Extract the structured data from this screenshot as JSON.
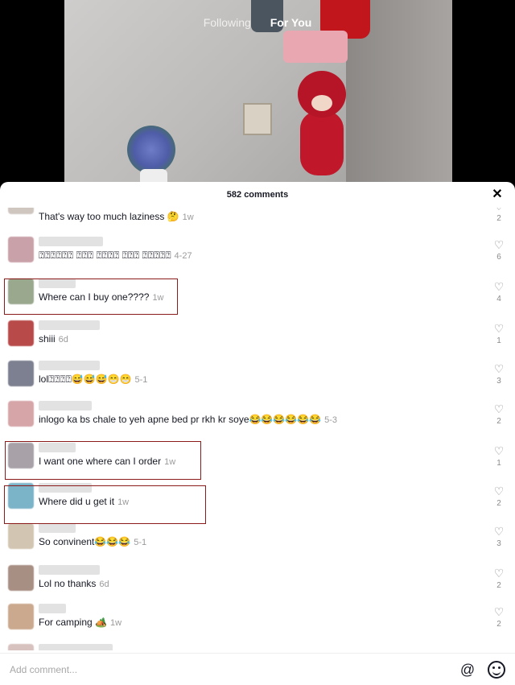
{
  "feed_tabs": {
    "following": "Following",
    "for_you": "For You"
  },
  "comments_header": "582 comments",
  "comments": [
    {
      "text": "That's way too much laziness 🤔",
      "time": "1w",
      "likes": "2",
      "avatar_color": "#cfc6c0"
    },
    {
      "text": "⍰⍰⍰⍰⍰⍰ ⍰⍰⍰ ⍰⍰⍰⍰ ⍰⍰⍰ ⍰⍰⍰⍰⍰",
      "time": "4-27",
      "likes": "6",
      "avatar_color": "#c9a1a8"
    },
    {
      "text": "Where can I buy one????",
      "time": "1w",
      "likes": "4",
      "avatar_color": "#9aa88e"
    },
    {
      "text": "shiii",
      "time": "6d",
      "likes": "1",
      "avatar_color": "#b84a4a"
    },
    {
      "text": "lol⍰⍰⍰⍰😅😅😅😁😁",
      "time": "5-1",
      "likes": "3",
      "avatar_color": "#7c8090"
    },
    {
      "text": "inlogo ka bs chale to yeh apne bed pr rkh kr soye😂😂😂😂😂😂",
      "time": "5-3",
      "likes": "2",
      "avatar_color": "#d6a5a8"
    },
    {
      "text": "I want one where can I order",
      "time": "1w",
      "likes": "1",
      "avatar_color": "#a8a2a8"
    },
    {
      "text": "Where did u get it",
      "time": "1w",
      "likes": "2",
      "avatar_color": "#7bb3c8"
    },
    {
      "text": "So convinent😂😂😂",
      "time": "5-1",
      "likes": "3",
      "avatar_color": "#d2c6b2"
    },
    {
      "text": "Lol no thanks",
      "time": "6d",
      "likes": "2",
      "avatar_color": "#a88f84"
    },
    {
      "text": "For camping 🏕️",
      "time": "1w",
      "likes": "2",
      "avatar_color": "#cba98e"
    }
  ],
  "input": {
    "placeholder": "Add comment..."
  },
  "icons": {
    "close": "close-icon",
    "heart": "heart-icon",
    "mention": "at-icon",
    "emoji": "emoji-icon"
  },
  "colors": {
    "highlight": "#8b1a1a",
    "text": "#161823",
    "muted": "#9a9a9a"
  }
}
